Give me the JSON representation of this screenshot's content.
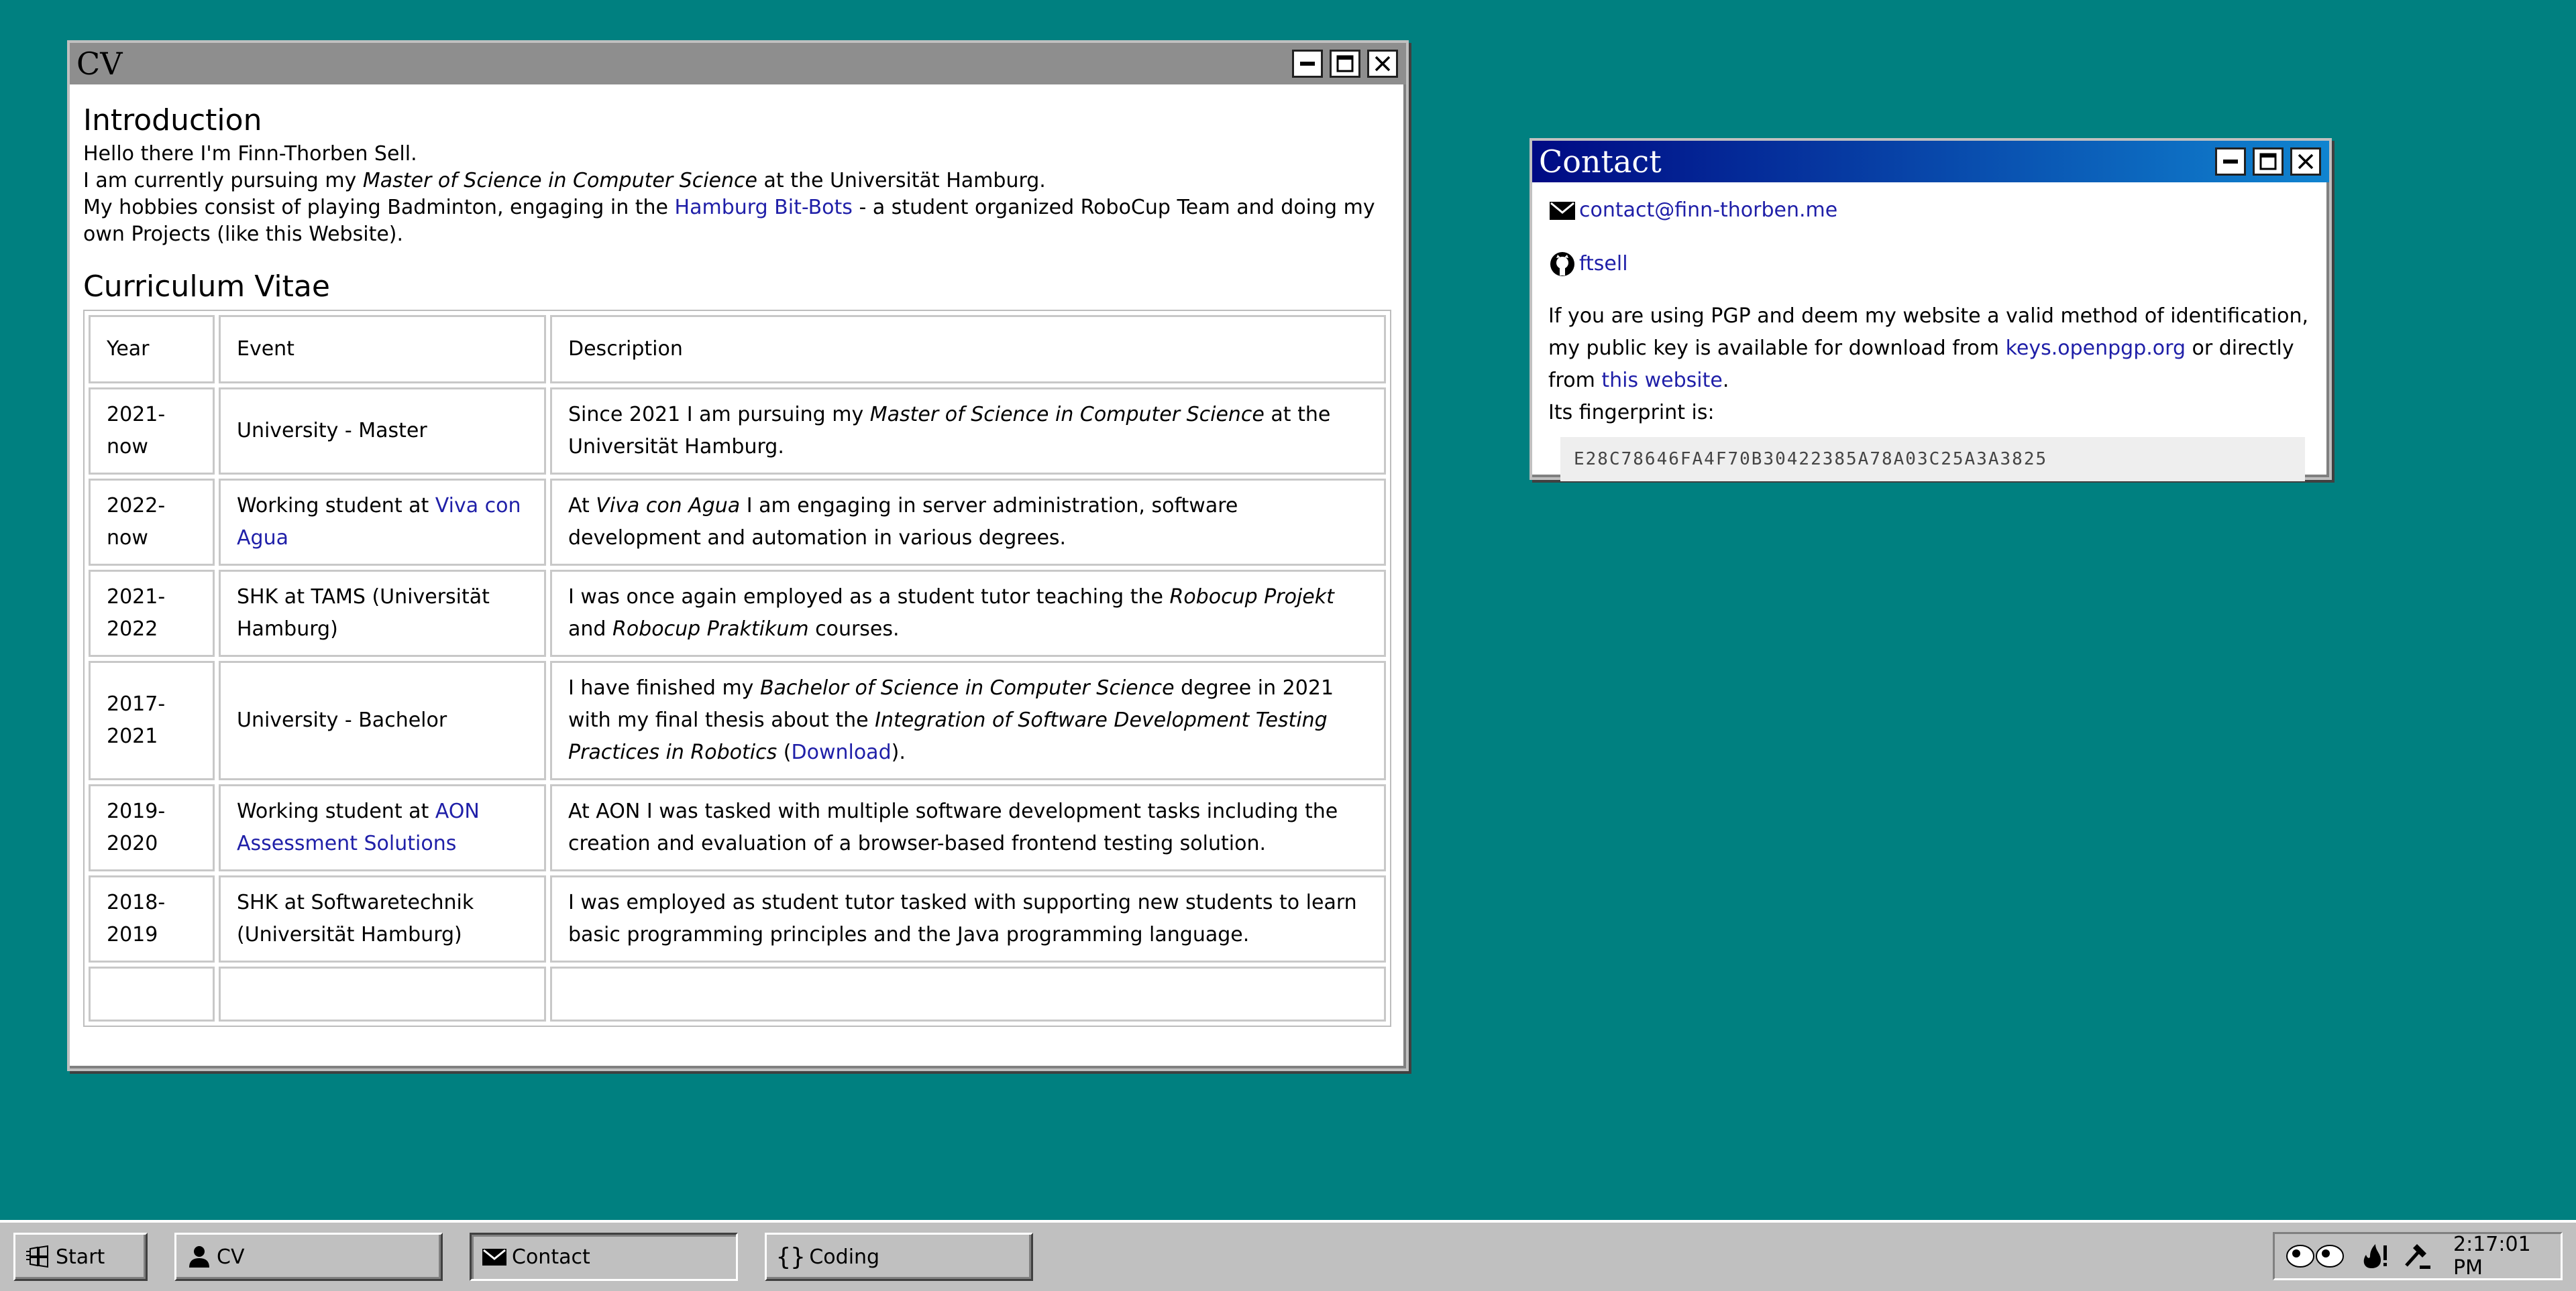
{
  "desktop": {
    "background_color": "#008080"
  },
  "cv_window": {
    "title": "CV",
    "intro_heading": "Introduction",
    "intro_line1": "Hello there I'm Finn-Thorben Sell.",
    "intro_line2_pre": "I am currently pursuing my ",
    "intro_line2_em": "Master of Science in Computer Science",
    "intro_line2_post": " at the Universität Hamburg.",
    "intro_line3_pre": "My hobbies consist of playing Badminton, engaging in the ",
    "intro_line3_link": "Hamburg Bit-Bots",
    "intro_line3_post": " - a student organized RoboCup Team and doing my own Projects (like this Website).",
    "cv_heading": "Curriculum Vitae",
    "table": {
      "headers": [
        "Year",
        "Event",
        "Description"
      ],
      "rows": [
        {
          "year": "2021-now",
          "event_pre": "University - Master",
          "event_link": "",
          "desc_1": "Since 2021 I am pursuing my ",
          "desc_em1": "Master of Science in Computer Science",
          "desc_2": " at the Universität Hamburg.",
          "desc_em2": "",
          "desc_3": "",
          "desc_link": "",
          "desc_4": ""
        },
        {
          "year": "2022-now",
          "event_pre": "Working student at ",
          "event_link": "Viva con Agua",
          "desc_1": "At ",
          "desc_em1": "Viva con Agua",
          "desc_2": " I am engaging in server administration, software development and automation in various degrees.",
          "desc_em2": "",
          "desc_3": "",
          "desc_link": "",
          "desc_4": ""
        },
        {
          "year": "2021-2022",
          "event_pre": "SHK at TAMS (Universität Hamburg)",
          "event_link": "",
          "desc_1": "I was once again employed as a student tutor teaching the ",
          "desc_em1": "Robocup Projekt",
          "desc_2": " and ",
          "desc_em2": "Robocup Praktikum",
          "desc_3": " courses.",
          "desc_link": "",
          "desc_4": ""
        },
        {
          "year": "2017-2021",
          "event_pre": "University - Bachelor",
          "event_link": "",
          "desc_1": "I have finished my ",
          "desc_em1": "Bachelor of Science in Computer Science",
          "desc_2": " degree in 2021 with my final thesis about the ",
          "desc_em2": "Integration of Software Development Testing Practices in Robotics",
          "desc_3": " (",
          "desc_link": "Download",
          "desc_4": ")."
        },
        {
          "year": "2019-2020",
          "event_pre": "Working student at ",
          "event_link": "AON Assessment Solutions",
          "desc_1": "At AON I was tasked with multiple software development tasks including the creation and evaluation of a browser-based frontend testing solution.",
          "desc_em1": "",
          "desc_2": "",
          "desc_em2": "",
          "desc_3": "",
          "desc_link": "",
          "desc_4": ""
        },
        {
          "year": "2018-2019",
          "event_pre": "SHK at Softwaretechnik (Universität Hamburg)",
          "event_link": "",
          "desc_1": "I was employed as student tutor tasked with supporting new students to learn basic programming principles and the Java programming language.",
          "desc_em1": "",
          "desc_2": "",
          "desc_em2": "",
          "desc_3": "",
          "desc_link": "",
          "desc_4": ""
        }
      ]
    }
  },
  "contact_window": {
    "title": "Contact",
    "email": "contact@finn-thorben.me",
    "github": "ftsell",
    "pgp_text_1": "If you are using PGP and deem my website a valid method of identification, my public key is available for download from ",
    "pgp_link_1": "keys.openpgp.org",
    "pgp_text_2": " or directly from ",
    "pgp_link_2": "this website",
    "pgp_text_3": ".",
    "fingerprint_label": "Its fingerprint is:",
    "fingerprint": "E28C78646FA4F70B30422385A78A03C25A3A3825"
  },
  "taskbar": {
    "start_label": "Start",
    "cv_label": "CV",
    "contact_label": "Contact",
    "coding_label": "Coding",
    "coding_icon_glyph": "{}",
    "clock": "2:17:01 PM"
  }
}
